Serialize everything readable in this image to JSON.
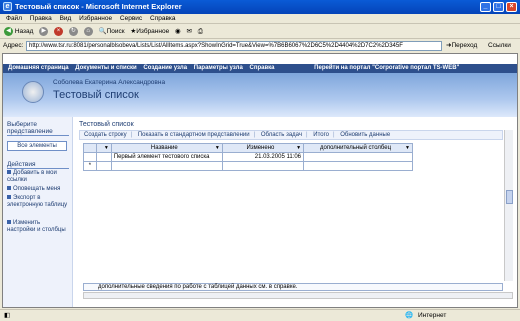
{
  "window": {
    "title": "Тестовый список - Microsoft Internet Explorer"
  },
  "menu": [
    "Файл",
    "Правка",
    "Вид",
    "Избранное",
    "Сервис",
    "Справка"
  ],
  "toolbar": {
    "back": "Назад",
    "search": "Поиск",
    "favorites": "Избранное"
  },
  "address": {
    "label": "Адрес:",
    "url": "http://www.tsr.ru:8081/personalblsobeva/Lists/List/AllItems.aspx?ShowInGrid=True&View=%7B6B6067%2D6C5%2D4404%2D7C2%2D345F",
    "go": "Переход",
    "links": "Ссылки"
  },
  "topnav": {
    "home": "Домашняя страница",
    "docs": "Документы и списки",
    "create": "Создание узла",
    "site_settings": "Параметры узла",
    "help": "Справка",
    "portal": "Перейти на портал \"Corporative портал TS-WEB\""
  },
  "header": {
    "subtitle": "Соболева Екатерина Александровна",
    "title": "Тестовый список"
  },
  "sidebar": {
    "select_view": "Выберите представление",
    "all_items": "Все элементы",
    "actions": "Действия",
    "add_to_my_links": "Добавить в мои ссылки",
    "alert_me": "Оповещать меня",
    "export": "Экспорт в электронную таблицу",
    "modify": "Изменить настройки и столбцы"
  },
  "list": {
    "label": "Тестовый список",
    "toolbar": [
      "Создать строку",
      "Показать в стандартном представлении",
      "Область задач",
      "Итого",
      "Обновить данные"
    ]
  },
  "grid": {
    "headers": [
      "Название",
      "Изменено",
      "дополнительный столбец"
    ],
    "rows": [
      {
        "title": "Первый элемент тестового списка",
        "modified": "21.03.2005 11:06",
        "extra": ""
      }
    ],
    "new_row_marker": "*"
  },
  "status_grid": {
    "text": "дополнительные сведения по работе с таблицей данных см. в справке."
  },
  "statusbar": {
    "zone": "Интернет"
  }
}
